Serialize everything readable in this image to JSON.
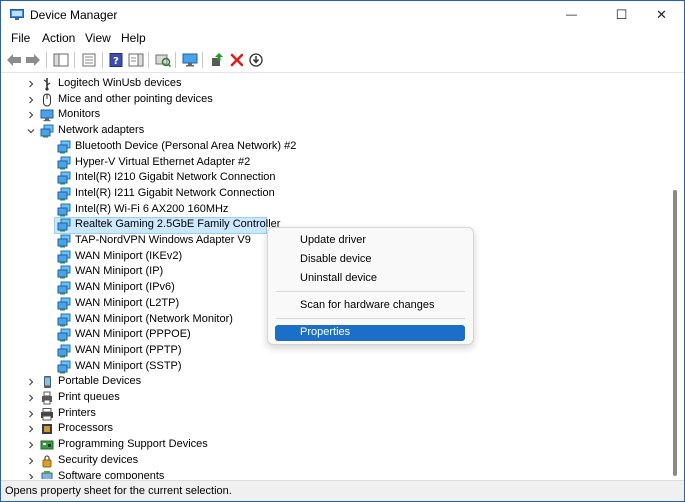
{
  "window": {
    "title": "Device Manager",
    "controls": {
      "minimize": "—",
      "maximize": "☐",
      "close": "✕"
    }
  },
  "menubar": {
    "items": [
      "File",
      "Action",
      "View",
      "Help"
    ]
  },
  "toolbar": {
    "icons": [
      "back-icon",
      "forward-icon",
      "console-tree-icon",
      "properties-icon",
      "help-icon",
      "action-pane-icon",
      "scan-hardware-icon",
      "monitor-icon",
      "update-driver-icon",
      "uninstall-icon",
      "disable-icon"
    ]
  },
  "tree": {
    "items": [
      {
        "label": "Logitech WinUsb devices",
        "level": 0,
        "expanded": false,
        "icon": "usb-device-icon"
      },
      {
        "label": "Mice and other pointing devices",
        "level": 0,
        "expanded": false,
        "icon": "mouse-icon"
      },
      {
        "label": "Monitors",
        "level": 0,
        "expanded": false,
        "icon": "monitor-icon"
      },
      {
        "label": "Network adapters",
        "level": 0,
        "expanded": true,
        "icon": "network-adapter-icon"
      },
      {
        "label": "Bluetooth Device (Personal Area Network) #2",
        "level": 1,
        "icon": "network-adapter-icon"
      },
      {
        "label": "Hyper-V Virtual Ethernet Adapter #2",
        "level": 1,
        "icon": "network-adapter-icon"
      },
      {
        "label": "Intel(R) I210 Gigabit Network Connection",
        "level": 1,
        "icon": "network-adapter-icon"
      },
      {
        "label": "Intel(R) I211 Gigabit Network Connection",
        "level": 1,
        "icon": "network-adapter-icon"
      },
      {
        "label": "Intel(R) Wi-Fi 6 AX200 160MHz",
        "level": 1,
        "icon": "network-adapter-icon"
      },
      {
        "label": "Realtek Gaming 2.5GbE Family Controller",
        "level": 1,
        "icon": "network-adapter-icon",
        "selected": true
      },
      {
        "label": "TAP-NordVPN Windows Adapter V9",
        "level": 1,
        "icon": "network-adapter-icon"
      },
      {
        "label": "WAN Miniport (IKEv2)",
        "level": 1,
        "icon": "network-adapter-icon"
      },
      {
        "label": "WAN Miniport (IP)",
        "level": 1,
        "icon": "network-adapter-icon"
      },
      {
        "label": "WAN Miniport (IPv6)",
        "level": 1,
        "icon": "network-adapter-icon"
      },
      {
        "label": "WAN Miniport (L2TP)",
        "level": 1,
        "icon": "network-adapter-icon"
      },
      {
        "label": "WAN Miniport (Network Monitor)",
        "level": 1,
        "icon": "network-adapter-icon"
      },
      {
        "label": "WAN Miniport (PPPOE)",
        "level": 1,
        "icon": "network-adapter-icon"
      },
      {
        "label": "WAN Miniport (PPTP)",
        "level": 1,
        "icon": "network-adapter-icon"
      },
      {
        "label": "WAN Miniport (SSTP)",
        "level": 1,
        "icon": "network-adapter-icon"
      },
      {
        "label": "Portable Devices",
        "level": 0,
        "expanded": false,
        "icon": "portable-device-icon"
      },
      {
        "label": "Print queues",
        "level": 0,
        "expanded": false,
        "icon": "print-queue-icon"
      },
      {
        "label": "Printers",
        "level": 0,
        "expanded": false,
        "icon": "printer-icon"
      },
      {
        "label": "Processors",
        "level": 0,
        "expanded": false,
        "icon": "processor-icon"
      },
      {
        "label": "Programming Support Devices",
        "level": 0,
        "expanded": false,
        "icon": "programming-device-icon"
      },
      {
        "label": "Security devices",
        "level": 0,
        "expanded": false,
        "icon": "security-device-icon"
      },
      {
        "label": "Software components",
        "level": 0,
        "expanded": false,
        "icon": "software-component-icon"
      }
    ]
  },
  "context_menu": {
    "items": [
      "Update driver",
      "Disable device",
      "Uninstall device",
      "Scan for hardware changes",
      "Properties"
    ],
    "highlighted": "Properties"
  },
  "statusbar": {
    "text": "Opens property sheet for the current selection."
  },
  "colors": {
    "accent": "#1c6fc9",
    "selection": "#cce8ff",
    "window_border": "#1e64b4"
  }
}
